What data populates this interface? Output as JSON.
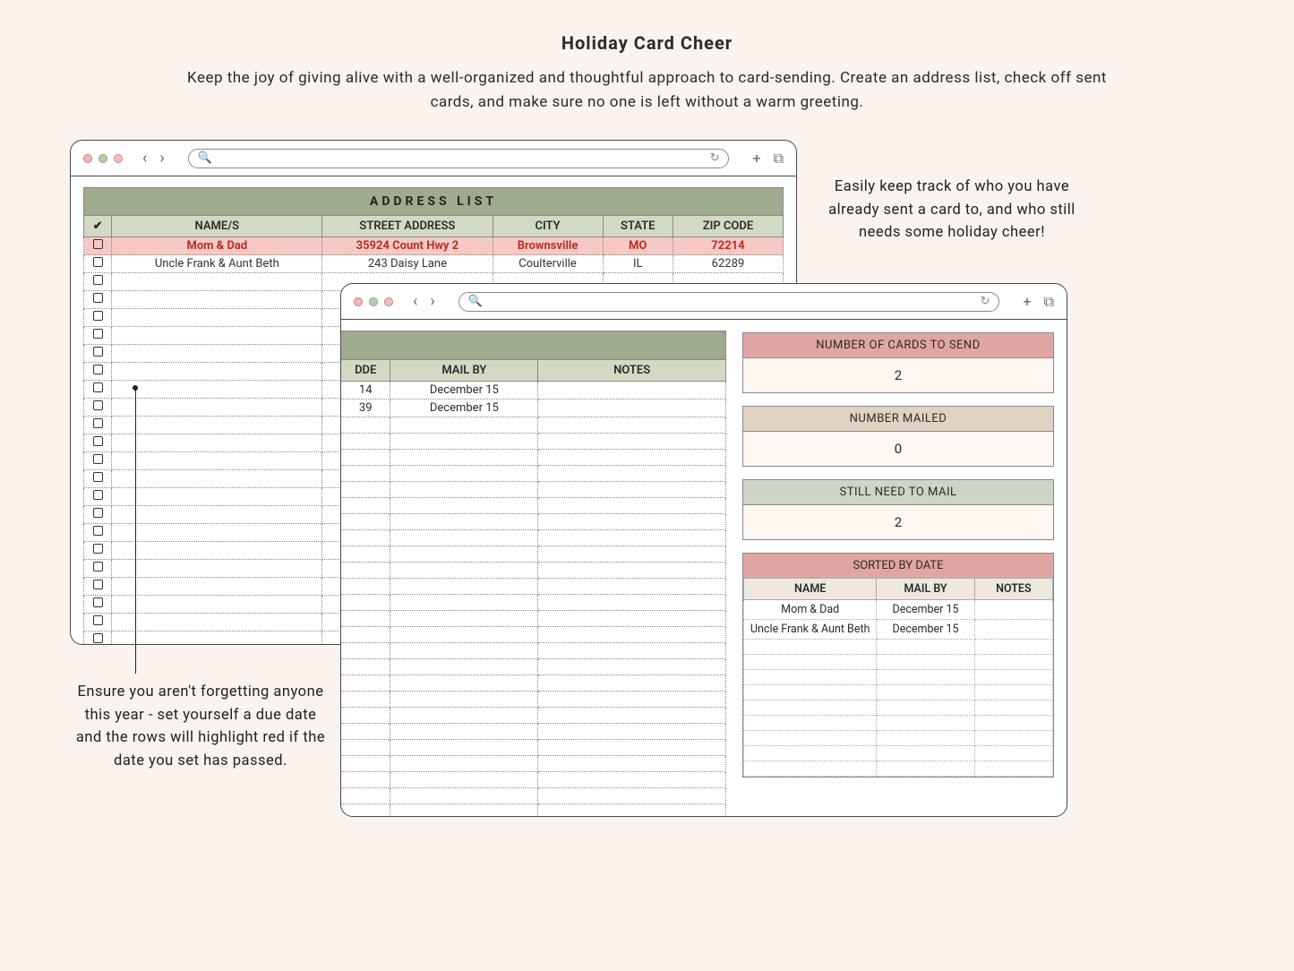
{
  "title": "Holiday Card Cheer",
  "subtitle": "Keep the joy of giving alive with a well-organized and thoughtful approach to card-sending. Create an address list, check off sent cards, and make sure no one is left without a warm greeting.",
  "callout_right": "Easily keep track of who you have already sent a card to, and who still needs some holiday cheer!",
  "callout_left": "Ensure you aren't forgetting anyone this year - set yourself a due date and the rows will highlight red if the date you set has passed.",
  "address_list": {
    "title": "ADDRESS LIST",
    "columns": [
      "✔",
      "NAME/S",
      "STREET ADDRESS",
      "CITY",
      "STATE",
      "ZIP CODE"
    ],
    "rows": [
      {
        "overdue": true,
        "name": "Mom & Dad",
        "street": "35924 Count Hwy 2",
        "city": "Brownsville",
        "state": "MO",
        "zip": "72214"
      },
      {
        "overdue": false,
        "name": "Uncle Frank & Aunt Beth",
        "street": "243 Daisy Lane",
        "city": "Coulterville",
        "state": "IL",
        "zip": "62289"
      }
    ],
    "blank_rows": 24
  },
  "extended_cols": {
    "columns": [
      "DDE",
      "MAIL BY",
      "NOTES"
    ],
    "rows": [
      {
        "dde": "14",
        "mailby": "December 15",
        "notes": ""
      },
      {
        "dde": "39",
        "mailby": "December 15",
        "notes": ""
      }
    ],
    "blank_rows": 27
  },
  "stats": {
    "to_send": {
      "label": "NUMBER OF CARDS TO SEND",
      "value": "2"
    },
    "mailed": {
      "label": "NUMBER MAILED",
      "value": "0"
    },
    "remaining": {
      "label": "STILL NEED TO MAIL",
      "value": "2"
    }
  },
  "sorted": {
    "title": "SORTED BY DATE",
    "columns": [
      "NAME",
      "MAIL BY",
      "NOTES"
    ],
    "rows": [
      {
        "name": "Mom & Dad",
        "mailby": "December 15",
        "notes": ""
      },
      {
        "name": "Uncle Frank & Aunt Beth",
        "mailby": "December 15",
        "notes": ""
      }
    ],
    "blank_rows": 9
  }
}
